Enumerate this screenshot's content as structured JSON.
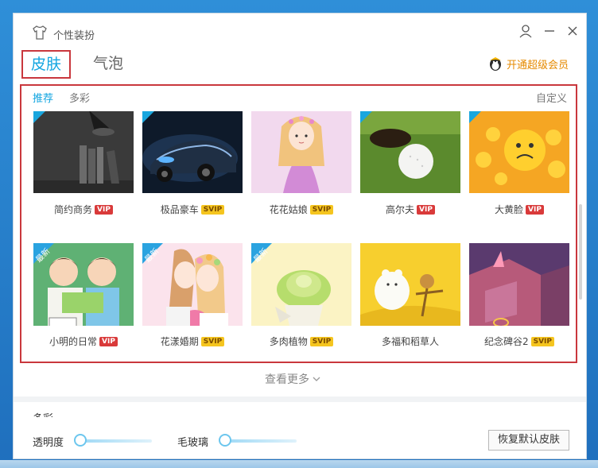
{
  "window": {
    "title": "个性装扮"
  },
  "tabs": [
    {
      "label": "皮肤"
    },
    {
      "label": "气泡"
    }
  ],
  "vip_link": {
    "label": "开通超级会员"
  },
  "subtabs": [
    {
      "label": "推荐"
    },
    {
      "label": "多彩"
    }
  ],
  "custom_label": "自定义",
  "skins": [
    {
      "name": "简约商务",
      "tag": "VIP",
      "new": false
    },
    {
      "name": "极品豪车",
      "tag": "SVIP",
      "new": false
    },
    {
      "name": "花花姑娘",
      "tag": "SVIP",
      "new": false
    },
    {
      "name": "高尔夫",
      "tag": "VIP",
      "new": false
    },
    {
      "name": "大黄脸",
      "tag": "VIP",
      "new": false
    },
    {
      "name": "小明的日常",
      "tag": "VIP",
      "new": true
    },
    {
      "name": "花漾婚期",
      "tag": "SVIP",
      "new": true
    },
    {
      "name": "多肉植物",
      "tag": "SVIP",
      "new": true
    },
    {
      "name": "多福和稻草人",
      "tag": "",
      "new": false
    },
    {
      "name": "纪念碑谷2",
      "tag": "SVIP",
      "new": false
    }
  ],
  "new_badge": "最新",
  "see_more": "查看更多",
  "section": {
    "title": "多彩",
    "opacity_label": "透明度",
    "frost_label": "毛玻璃",
    "opacity_level": 0.0,
    "frost_level": 0.0
  },
  "restore_button": "恢复默认皮肤",
  "colors": {
    "accent": "#12a5e0",
    "highlight_border": "#c9373d",
    "vip": "#d93a3a",
    "svip": "#f5c51f"
  }
}
